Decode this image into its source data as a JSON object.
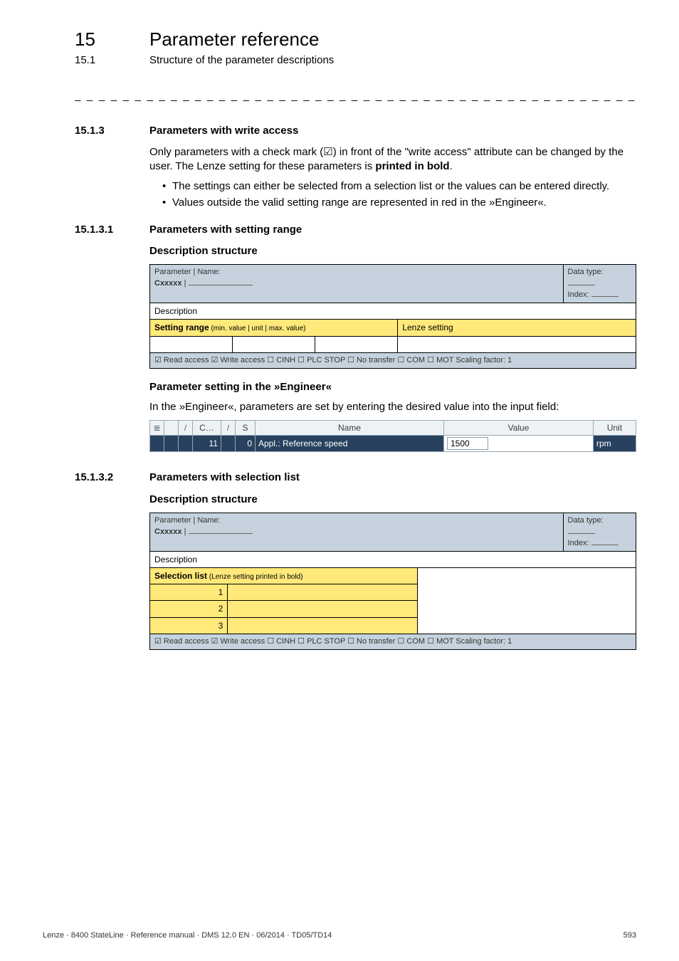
{
  "chapter": {
    "num": "15",
    "title": "Parameter reference"
  },
  "subchapter": {
    "num": "15.1",
    "title": "Structure of the parameter descriptions"
  },
  "dashes": "_ _ _ _ _ _ _ _ _ _ _ _ _ _ _ _ _ _ _ _ _ _ _ _ _ _ _ _ _ _ _ _ _ _ _ _ _ _ _ _ _ _ _ _ _ _ _ _ _ _ _ _ _ _ _ _ _ _ _ _ _ _ _ _",
  "s1513": {
    "num": "15.1.3",
    "title": "Parameters with write access",
    "para1_a": "Only parameters with a check mark (",
    "para1_check": "☑",
    "para1_b": ") in front of the \"write access\" attribute can be changed by the user. The Lenze setting for these parameters is ",
    "para1_bold": "printed in bold",
    "para1_c": ".",
    "bullets": [
      "The settings can either be selected from a selection list or the values can be entered directly.",
      "Values outside the valid setting range are represented in red in the »Engineer«."
    ]
  },
  "s15131": {
    "num": "15.1.3.1",
    "title": "Parameters with setting range",
    "desc_heading": "Description structure",
    "table": {
      "param_name_label": "Parameter | Name:",
      "cxxxxx": "Cxxxxx",
      "data_type_label": "Data type:",
      "index_label": "Index:",
      "description_label": "Description",
      "setting_range_main": "Setting range",
      "setting_range_sub": " (min. value | unit | max. value)",
      "lenze_setting": "Lenze setting",
      "bottom": "☑ Read access   ☑ Write access   ☐ CINH   ☐ PLC STOP   ☐ No transfer   ☐ COM   ☐ MOT    Scaling factor: 1"
    },
    "param_setting_heading": "Parameter setting in the »Engineer«",
    "param_setting_text": "In the »Engineer«, parameters are set by entering the desired value into the input field:",
    "engineer": {
      "head_misc": "/",
      "head_c": "C…",
      "head_s": "S",
      "head_name": "Name",
      "head_value": "Value",
      "head_unit": "Unit",
      "row_c": "11",
      "row_s": "0",
      "row_name": "Appl.: Reference speed",
      "row_value": "1500",
      "row_unit": "rpm"
    }
  },
  "s15132": {
    "num": "15.1.3.2",
    "title": "Parameters with selection list",
    "desc_heading": "Description structure",
    "table": {
      "param_name_label": "Parameter | Name:",
      "cxxxxx": "Cxxxxx",
      "data_type_label": "Data type:",
      "index_label": "Index:",
      "description_label": "Description",
      "selection_main": "Selection list",
      "selection_sub": " (Lenze setting printed in bold)",
      "rows": [
        "1",
        "2",
        "3"
      ],
      "bottom": "☑ Read access   ☑ Write access   ☐ CINH   ☐ PLC STOP   ☐ No transfer   ☐ COM   ☐ MOT    Scaling factor: 1"
    }
  },
  "footer": {
    "left": "Lenze · 8400 StateLine · Reference manual · DMS 12.0 EN · 06/2014 · TD05/TD14",
    "right": "593"
  }
}
